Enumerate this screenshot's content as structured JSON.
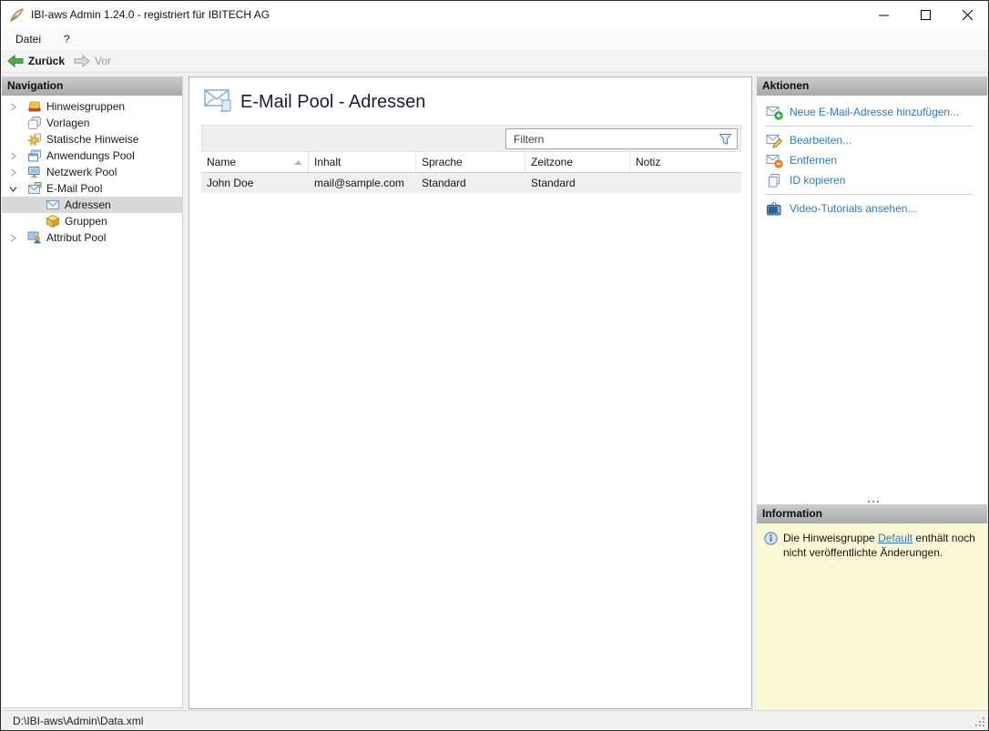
{
  "window": {
    "title": "IBI-aws Admin 1.24.0 - registriert für IBITECH AG"
  },
  "menu": {
    "items": [
      {
        "label": "Datei"
      },
      {
        "label": "?"
      }
    ]
  },
  "toolbar": {
    "back_label": "Zurück",
    "forward_label": "Vor"
  },
  "navigation": {
    "header": "Navigation",
    "items": [
      {
        "label": "Hinweisgruppen",
        "icon": "notice-groups-icon",
        "expander": "collapsed",
        "level": 0,
        "selected": false
      },
      {
        "label": "Vorlagen",
        "icon": "templates-icon",
        "expander": "none",
        "level": 0,
        "selected": false
      },
      {
        "label": "Statische Hinweise",
        "icon": "static-notices-icon",
        "expander": "none",
        "level": 0,
        "selected": false
      },
      {
        "label": "Anwendungs Pool",
        "icon": "application-pool-icon",
        "expander": "collapsed",
        "level": 0,
        "selected": false
      },
      {
        "label": "Netzwerk Pool",
        "icon": "network-pool-icon",
        "expander": "collapsed",
        "level": 0,
        "selected": false
      },
      {
        "label": "E-Mail Pool",
        "icon": "email-pool-icon",
        "expander": "expanded",
        "level": 0,
        "selected": false
      },
      {
        "label": "Adressen",
        "icon": "addresses-icon",
        "expander": "none",
        "level": 1,
        "selected": true
      },
      {
        "label": "Gruppen",
        "icon": "groups-icon",
        "expander": "none",
        "level": 1,
        "selected": false
      },
      {
        "label": "Attribut Pool",
        "icon": "attribute-pool-icon",
        "expander": "collapsed",
        "level": 0,
        "selected": false
      }
    ]
  },
  "content": {
    "title": "E-Mail Pool - Adressen",
    "filter_placeholder": "Filtern",
    "table": {
      "columns": [
        "Name",
        "Inhalt",
        "Sprache",
        "Zeitzone",
        "Notiz"
      ],
      "sort_column": "Name",
      "sort_direction": "ascending",
      "rows": [
        [
          "John Doe",
          "mail@sample.com",
          "Standard",
          "Standard",
          ""
        ]
      ]
    }
  },
  "actions": {
    "header": "Aktionen",
    "groups": [
      [
        {
          "label": "Neue E-Mail-Adresse hinzufügen...",
          "icon": "email-add-icon"
        }
      ],
      [
        {
          "label": "Bearbeiten...",
          "icon": "email-edit-icon"
        },
        {
          "label": "Entfernen",
          "icon": "email-remove-icon"
        },
        {
          "label": "ID kopieren",
          "icon": "copy-icon"
        }
      ],
      [
        {
          "label": "Video-Tutorials ansehen...",
          "icon": "video-tutorials-icon"
        }
      ]
    ]
  },
  "information": {
    "header": "Information",
    "text_before": "Die Hinweisgruppe ",
    "link_label": "Default",
    "text_after": " enthält noch nicht veröffentlichte Änderungen."
  },
  "statusbar": {
    "path": "D:\\IBI-aws\\Admin\\Data.xml"
  }
}
